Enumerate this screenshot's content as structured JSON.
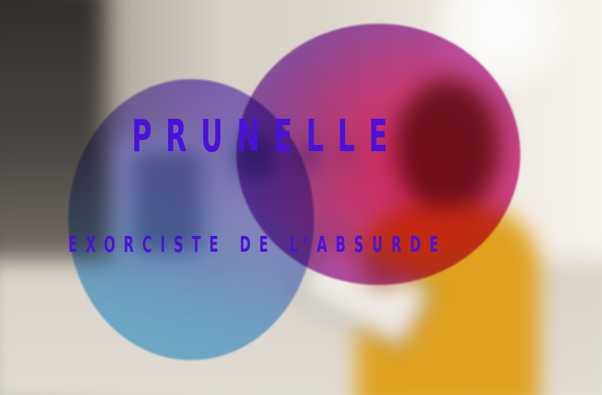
{
  "hero": {
    "title": "PRUNELLE",
    "subtitle": "EXORCISTE DE L’ABSURDE"
  },
  "colors": {
    "text_accent": "#4a12d8",
    "circle_pink": "#e41c5c",
    "circle_blue": "#5cbef0",
    "circle_purple": "#7e4ed6"
  },
  "background": {
    "description_icon": "gallery-photo-blurred"
  }
}
